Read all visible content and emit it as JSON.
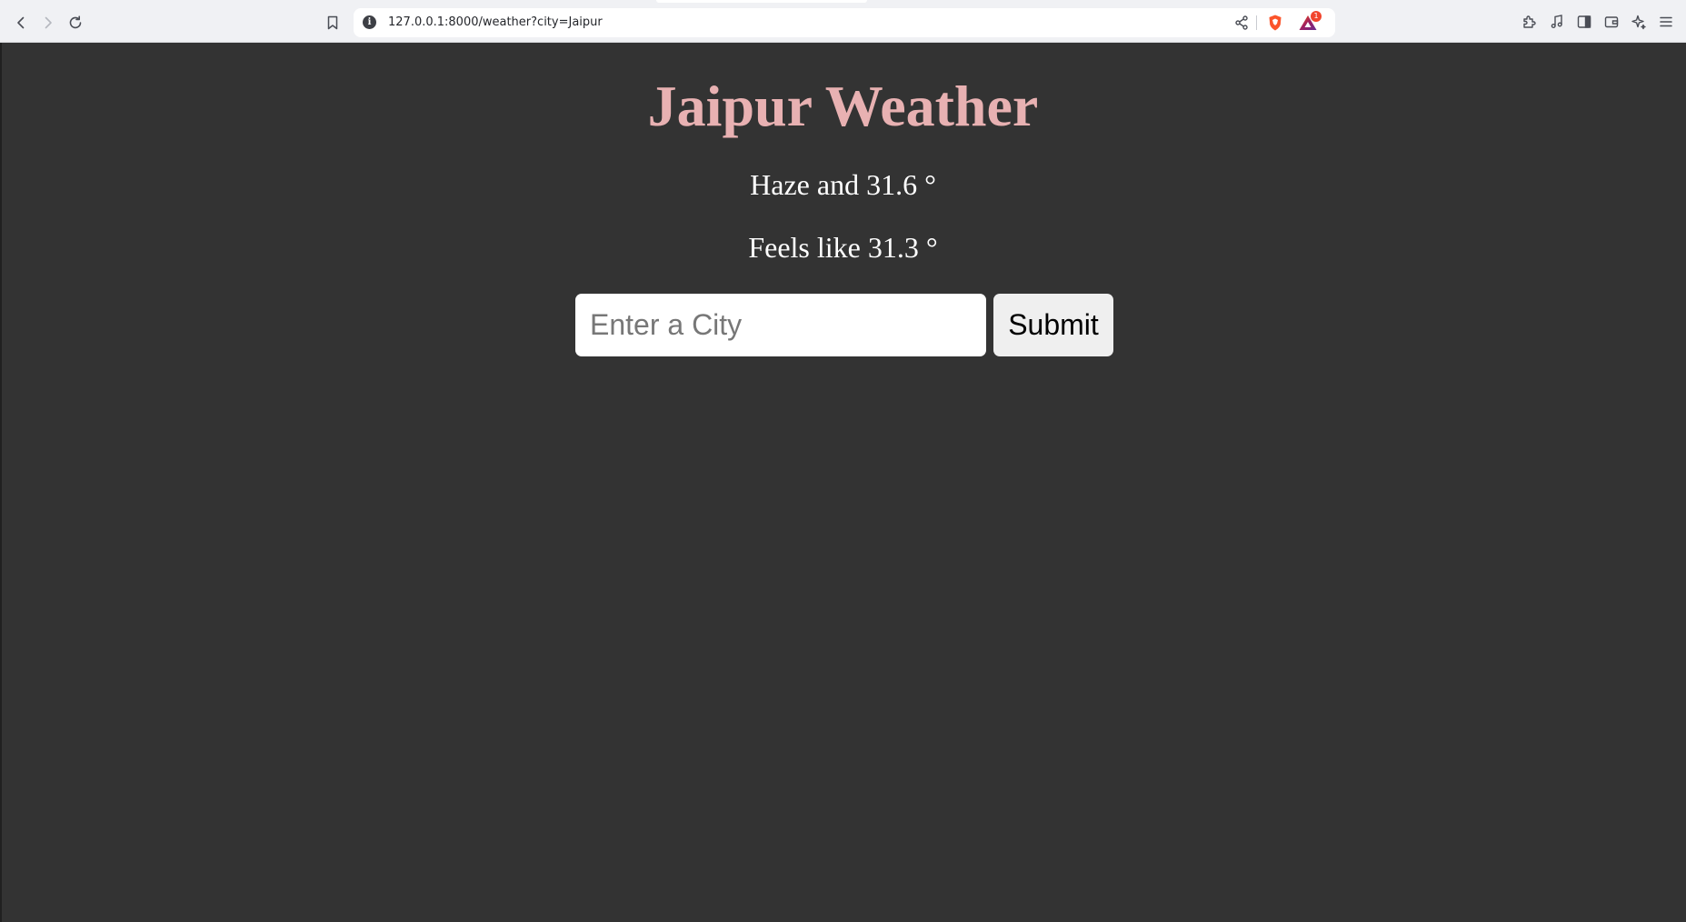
{
  "browser": {
    "url": "127.0.0.1:8000/weather?city=Jaipur",
    "rewards_badge_count": "1",
    "icons": {
      "back": "arrow-left-icon",
      "forward": "arrow-right-icon",
      "reload": "reload-icon",
      "bookmark": "bookmark-icon",
      "site_info": "info-icon",
      "share": "share-icon",
      "shield": "brave-shield-icon",
      "rewards": "brave-rewards-icon",
      "extensions": "puzzle-icon",
      "media": "music-note-icon",
      "sidebar": "sidebar-icon",
      "wallet": "wallet-icon",
      "leo": "sparkle-icon",
      "menu": "hamburger-menu-icon"
    }
  },
  "weather": {
    "title": "Jaipur Weather",
    "condition_text": "Haze and 31.6 °",
    "feels_like_text": "Feels like 31.3 °"
  },
  "form": {
    "city_placeholder": "Enter a City",
    "city_value": "",
    "submit_label": "Submit"
  },
  "colors": {
    "page_background": "#333333",
    "title": "#e8b1b2",
    "text": "#ffffff",
    "brave_orange": "#fb542b",
    "badge_red": "#f1452d"
  }
}
